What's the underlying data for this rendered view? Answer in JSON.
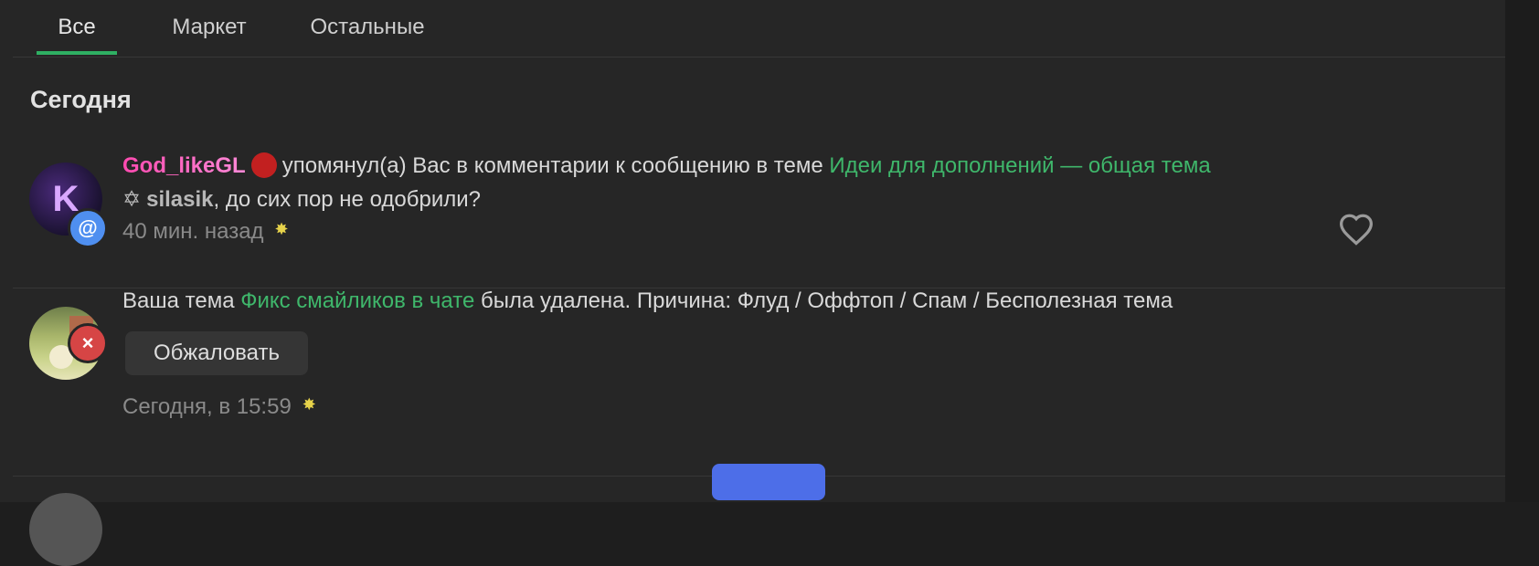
{
  "tabs": [
    {
      "label": "Все",
      "active": true
    },
    {
      "label": "Маркет",
      "active": false
    },
    {
      "label": "Остальные",
      "active": false
    }
  ],
  "section": {
    "title": "Сегодня"
  },
  "colors": {
    "accent": "#2fb063",
    "link": "#3fb76b",
    "username": "#ff4ab0",
    "mention_badge": "#4f8ff0",
    "delete_badge": "#d64545"
  },
  "notifications": [
    {
      "username": "God_likeGL",
      "action": "упомянул(а) Вас в комментарии к сообщению в теме",
      "thread": "Идеи для дополнений — общая тема",
      "quote_name": "silasik",
      "quote_text": ", до сих пор не одобрили?",
      "time": "40 мин. назад",
      "badge_icon": "@",
      "avatar_letter": "K"
    },
    {
      "prefix": "Ваша тема",
      "thread": "Фикс смайликов в чате",
      "suffix": "была удалена. Причина: Флуд / Оффтоп / Спам / Бесполезная тема",
      "appeal_label": "Обжаловать",
      "time": "Сегодня, в 15:59",
      "badge_icon": "×"
    }
  ]
}
